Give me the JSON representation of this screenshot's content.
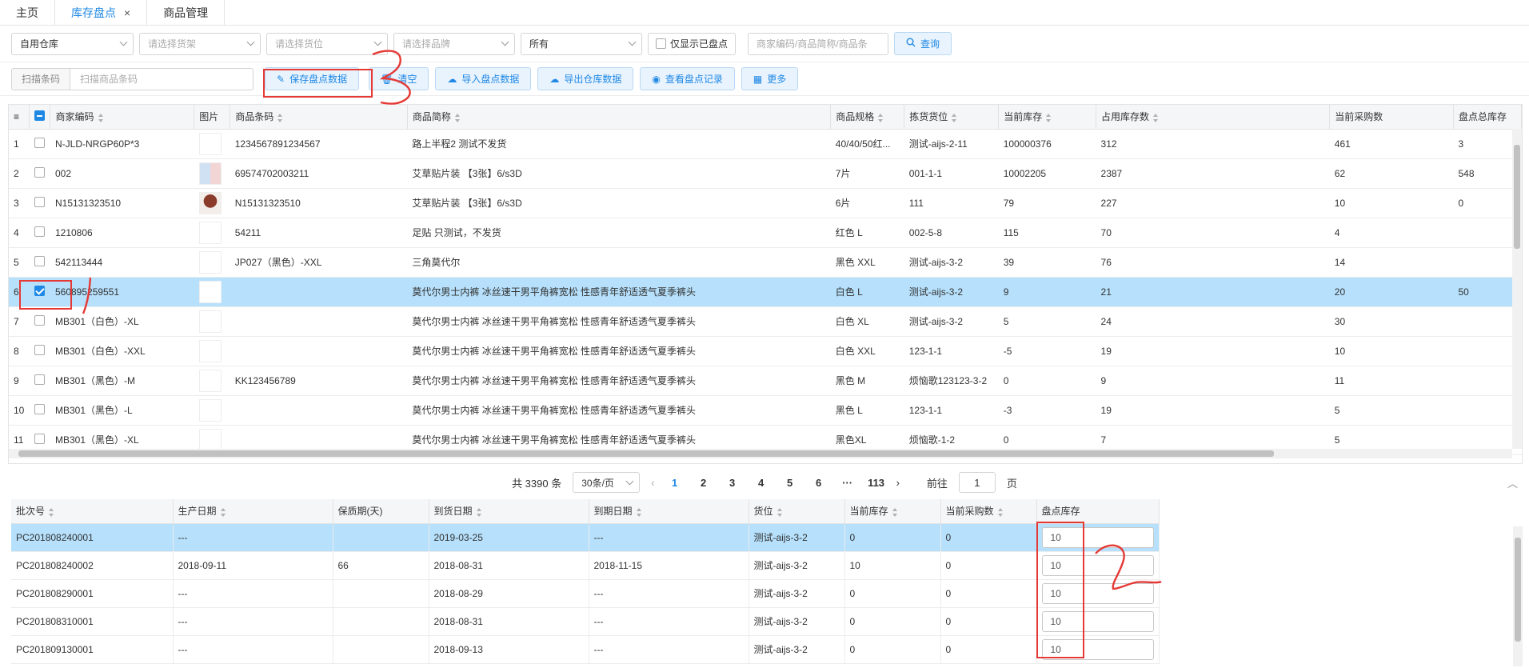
{
  "tabs": [
    {
      "label": "主页"
    },
    {
      "label": "库存盘点",
      "close": "×"
    },
    {
      "label": "商品管理"
    }
  ],
  "filters": {
    "warehouse": "自用仓库",
    "shelf_ph": "请选择货架",
    "location_ph": "请选择货位",
    "brand_ph": "请选择品牌",
    "status": "所有",
    "only_checked": "仅显示已盘点",
    "search_ph": "商家编码/商品简称/商品条",
    "query": "查询"
  },
  "toolbar": {
    "scan_label": "扫描条码",
    "scan_ph": "扫描商品条码",
    "save": "保存盘点数据",
    "clear": "清空",
    "import": "导入盘点数据",
    "export": "导出仓库数据",
    "records": "查看盘点记录",
    "more": "更多"
  },
  "grid": {
    "headers": [
      "商家编码",
      "图片",
      "商品条码",
      "商品简称",
      "商品规格",
      "拣货货位",
      "当前库存",
      "占用库存数",
      "当前采购数",
      "盘点总库存"
    ],
    "rows": [
      {
        "idx": "1",
        "code": "N-JLD-NRGP60P*3",
        "barcode": "1234567891234567",
        "name": "路上半程2 测试不发货",
        "spec": "40/40/50红...",
        "loc": "测试-aijs-2-11",
        "stock": "100000376",
        "occupied": "312",
        "purchase": "461",
        "total": "3",
        "img": "logo"
      },
      {
        "idx": "2",
        "code": "002",
        "barcode": "69574702003211",
        "name": "艾草贴片装 【3张】6/s3D",
        "spec": "7片",
        "loc": "001-1-1",
        "stock": "10002205",
        "occupied": "2387",
        "purchase": "62",
        "total": "548",
        "img": "img2"
      },
      {
        "idx": "3",
        "code": "N15131323510",
        "barcode": "N15131323510",
        "name": "艾草贴片装 【3张】6/s3D",
        "spec": "6片",
        "loc": "111",
        "stock": "79",
        "occupied": "227",
        "purchase": "10",
        "total": "0",
        "img": "img3"
      },
      {
        "idx": "4",
        "code": "1210806",
        "barcode": "54211",
        "name": "足贴 只测试，不发货",
        "spec": "红色 L",
        "loc": "002-5-8",
        "stock": "115",
        "occupied": "70",
        "purchase": "4",
        "total": "",
        "img": "logo"
      },
      {
        "idx": "5",
        "code": "542113444",
        "barcode": "JP027（黑色）-XXL",
        "name": "三角莫代尔",
        "spec": "黑色 XXL",
        "loc": "测试-aijs-3-2",
        "stock": "39",
        "occupied": "76",
        "purchase": "14",
        "total": "",
        "img": "logo"
      },
      {
        "idx": "6",
        "code": "560895259551",
        "barcode": "",
        "name": "莫代尔男士内裤 冰丝速干男平角裤宽松 性感青年舒适透气夏季裤头",
        "spec": "白色 L",
        "loc": "测试-aijs-3-2",
        "stock": "9",
        "occupied": "21",
        "purchase": "20",
        "total": "50",
        "img": "logo",
        "selected": true
      },
      {
        "idx": "7",
        "code": "MB301（白色）-XL",
        "barcode": "",
        "name": "莫代尔男士内裤 冰丝速干男平角裤宽松 性感青年舒适透气夏季裤头",
        "spec": "白色 XL",
        "loc": "测试-aijs-3-2",
        "stock": "5",
        "occupied": "24",
        "purchase": "30",
        "total": "",
        "img": "logo"
      },
      {
        "idx": "8",
        "code": "MB301（白色）-XXL",
        "barcode": "",
        "name": "莫代尔男士内裤 冰丝速干男平角裤宽松 性感青年舒适透气夏季裤头",
        "spec": "白色 XXL",
        "loc": "123-1-1",
        "stock": "-5",
        "occupied": "19",
        "purchase": "10",
        "total": "",
        "img": "logo"
      },
      {
        "idx": "9",
        "code": "MB301（黑色）-M",
        "barcode": "KK123456789",
        "name": "莫代尔男士内裤 冰丝速干男平角裤宽松 性感青年舒适透气夏季裤头",
        "spec": "黑色 M",
        "loc": "烦恼歌123123-3-2",
        "stock": "0",
        "occupied": "9",
        "purchase": "11",
        "total": "",
        "img": "logo"
      },
      {
        "idx": "10",
        "code": "MB301（黑色）-L",
        "barcode": "",
        "name": "莫代尔男士内裤 冰丝速干男平角裤宽松 性感青年舒适透气夏季裤头",
        "spec": "黑色 L",
        "loc": "123-1-1",
        "stock": "-3",
        "occupied": "19",
        "purchase": "5",
        "total": "",
        "img": "logo"
      },
      {
        "idx": "11",
        "code": "MB301（黑色）-XL",
        "barcode": "",
        "name": "莫代尔男士内裤 冰丝速干男平角裤宽松 性感青年舒适透气夏季裤头",
        "spec": "黑色XL",
        "loc": "烦恼歌-1-2",
        "stock": "0",
        "occupied": "7",
        "purchase": "5",
        "total": "",
        "img": "logo"
      }
    ]
  },
  "pager": {
    "total": "共 3390 条",
    "per_page": "30条/页",
    "pages": [
      "1",
      "2",
      "3",
      "4",
      "5",
      "6",
      "···",
      "113"
    ],
    "goto": "前往",
    "goto_value": "1",
    "page_suffix": "页"
  },
  "batch": {
    "headers": [
      "批次号",
      "生产日期",
      "保质期(天)",
      "到货日期",
      "到期日期",
      "货位",
      "当前库存",
      "当前采购数",
      "盘点库存"
    ],
    "rows": [
      {
        "batch": "PC201808240001",
        "prod": "---",
        "shelf_life": "",
        "arrive": "2019-03-25",
        "expire": "---",
        "loc": "测试-aijs-3-2",
        "stock": "0",
        "purchase": "0",
        "qty": "10",
        "selected": true
      },
      {
        "batch": "PC201808240002",
        "prod": "2018-09-11",
        "shelf_life": "66",
        "arrive": "2018-08-31",
        "expire": "2018-11-15",
        "loc": "测试-aijs-3-2",
        "stock": "10",
        "purchase": "0",
        "qty": "10"
      },
      {
        "batch": "PC201808290001",
        "prod": "---",
        "shelf_life": "",
        "arrive": "2018-08-29",
        "expire": "---",
        "loc": "测试-aijs-3-2",
        "stock": "0",
        "purchase": "0",
        "qty": "10"
      },
      {
        "batch": "PC201808310001",
        "prod": "---",
        "shelf_life": "",
        "arrive": "2018-08-31",
        "expire": "---",
        "loc": "测试-aijs-3-2",
        "stock": "0",
        "purchase": "0",
        "qty": "10"
      },
      {
        "batch": "PC201809130001",
        "prod": "---",
        "shelf_life": "",
        "arrive": "2018-09-13",
        "expire": "---",
        "loc": "测试-aijs-3-2",
        "stock": "0",
        "purchase": "0",
        "qty": "10"
      }
    ]
  },
  "colors": {
    "accent": "#1f88e5",
    "selected_row": "#b6e0fb",
    "annotation": "#e53935"
  }
}
